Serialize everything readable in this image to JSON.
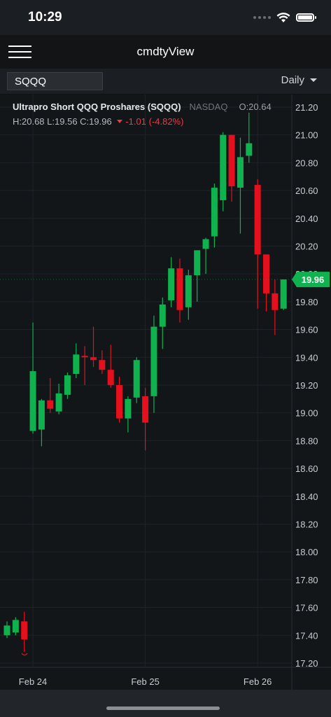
{
  "status_bar": {
    "time": "10:29"
  },
  "header": {
    "title": "cmdtyView"
  },
  "toolbar": {
    "symbol_value": "SQQQ",
    "interval_label": "Daily"
  },
  "legend": {
    "name": "Ultrapro Short QQQ Proshares (SQQQ)",
    "exchange": "NASDAQ",
    "open": "O:20.64",
    "high": "H:20.68",
    "low": "L:19.56",
    "close": "C:19.96",
    "change": "-1.01 (-4.82%)"
  },
  "colors": {
    "up": "#0fb24f",
    "down": "#e5101d",
    "background": "#131619",
    "price_tag": "#0fb24f"
  },
  "chart_data": {
    "type": "candlestick",
    "y_ticks": [
      "21.20",
      "21.00",
      "20.80",
      "20.60",
      "20.40",
      "20.20",
      "20.00",
      "19.80",
      "19.60",
      "19.40",
      "19.20",
      "19.00",
      "18.80",
      "18.60",
      "18.40",
      "18.20",
      "18.00",
      "17.80",
      "17.60",
      "17.40",
      "17.20"
    ],
    "ylim": [
      17.15,
      21.25
    ],
    "x_labels": [
      {
        "label": "Feb 24",
        "index": 3
      },
      {
        "label": "Feb 25",
        "index": 16
      },
      {
        "label": "Feb 26",
        "index": 29
      }
    ],
    "current_price_label": "19.96",
    "current_price": 19.96,
    "candles": [
      {
        "o": 17.4,
        "h": 17.5,
        "l": 17.38,
        "c": 17.47
      },
      {
        "o": 17.42,
        "h": 17.53,
        "l": 17.4,
        "c": 17.51
      },
      {
        "o": 17.5,
        "h": 17.57,
        "l": 17.28,
        "c": 17.37
      },
      {
        "o": 18.87,
        "h": 19.65,
        "l": 18.85,
        "c": 19.3
      },
      {
        "o": 18.88,
        "h": 19.1,
        "l": 18.76,
        "c": 19.09
      },
      {
        "o": 19.09,
        "h": 19.25,
        "l": 19.0,
        "c": 19.03
      },
      {
        "o": 19.01,
        "h": 19.21,
        "l": 18.99,
        "c": 19.14
      },
      {
        "o": 19.13,
        "h": 19.29,
        "l": 19.1,
        "c": 19.27
      },
      {
        "o": 19.28,
        "h": 19.5,
        "l": 19.25,
        "c": 19.42
      },
      {
        "o": 19.41,
        "h": 19.48,
        "l": 19.2,
        "c": 19.4
      },
      {
        "o": 19.4,
        "h": 19.62,
        "l": 19.33,
        "c": 19.38
      },
      {
        "o": 19.38,
        "h": 19.45,
        "l": 19.28,
        "c": 19.31
      },
      {
        "o": 19.31,
        "h": 19.49,
        "l": 19.18,
        "c": 19.2
      },
      {
        "o": 19.2,
        "h": 19.26,
        "l": 18.93,
        "c": 18.96
      },
      {
        "o": 18.96,
        "h": 19.12,
        "l": 18.86,
        "c": 19.1
      },
      {
        "o": 19.11,
        "h": 19.4,
        "l": 19.07,
        "c": 19.38
      },
      {
        "o": 19.12,
        "h": 19.18,
        "l": 18.73,
        "c": 18.93
      },
      {
        "o": 19.12,
        "h": 19.7,
        "l": 19.0,
        "c": 19.62
      },
      {
        "o": 19.62,
        "h": 19.83,
        "l": 19.46,
        "c": 19.78
      },
      {
        "o": 19.81,
        "h": 20.12,
        "l": 19.76,
        "c": 20.04
      },
      {
        "o": 20.04,
        "h": 20.11,
        "l": 19.65,
        "c": 19.74
      },
      {
        "o": 19.76,
        "h": 20.03,
        "l": 19.67,
        "c": 19.99
      },
      {
        "o": 19.99,
        "h": 20.16,
        "l": 19.8,
        "c": 20.17
      },
      {
        "o": 20.18,
        "h": 20.26,
        "l": 20.0,
        "c": 20.25
      },
      {
        "o": 20.27,
        "h": 20.65,
        "l": 20.19,
        "c": 20.62
      },
      {
        "o": 20.53,
        "h": 21.02,
        "l": 20.45,
        "c": 21.0
      },
      {
        "o": 21.0,
        "h": 21.0,
        "l": 20.52,
        "c": 20.63
      },
      {
        "o": 20.62,
        "h": 20.98,
        "l": 20.29,
        "c": 20.84
      },
      {
        "o": 20.85,
        "h": 21.16,
        "l": 20.8,
        "c": 20.94
      },
      {
        "o": 20.64,
        "h": 20.68,
        "l": 19.75,
        "c": 20.14
      },
      {
        "o": 20.14,
        "h": 20.1,
        "l": 19.73,
        "c": 19.86
      },
      {
        "o": 19.86,
        "h": 19.96,
        "l": 19.56,
        "c": 19.74
      },
      {
        "o": 19.75,
        "h": 19.96,
        "l": 19.74,
        "c": 19.96
      }
    ]
  }
}
